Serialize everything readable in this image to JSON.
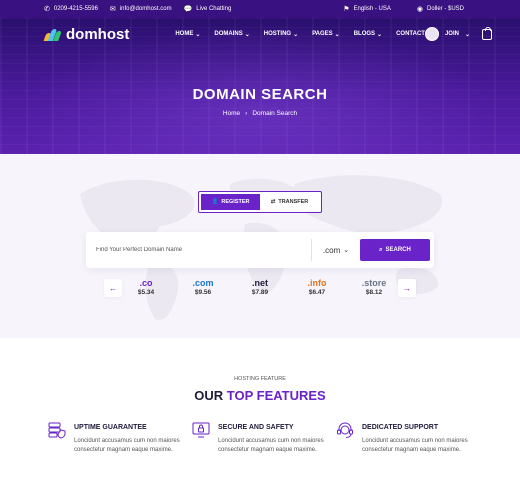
{
  "topbar": {
    "phone": "0209-4215-5596",
    "email": "info@domhost.com",
    "chat": "Live Chatting",
    "language": "English - USA",
    "currency": "Doller - $USD"
  },
  "brand": {
    "name": "domhost"
  },
  "nav": {
    "items": [
      {
        "label": "HOME"
      },
      {
        "label": "DOMAINS"
      },
      {
        "label": "HOSTING"
      },
      {
        "label": "PAGES"
      },
      {
        "label": "BLOGS"
      },
      {
        "label": "CONTACT"
      }
    ],
    "join": "JOIN"
  },
  "hero": {
    "title": "DOMAIN SEARCH",
    "breadcrumb": {
      "home": "Home",
      "separator": "›",
      "current": "Domain Search"
    }
  },
  "search": {
    "tabs": {
      "register": "REGISTER",
      "transfer": "TRANSFER"
    },
    "placeholder": "Find Your Perfect Domain Name",
    "tld_selected": ".com",
    "button": "SEARCH",
    "tlds": [
      {
        "ext": ".co",
        "price": "$5.34",
        "color": "#6a22c9"
      },
      {
        "ext": ".com",
        "price": "$9.56",
        "color": "#1a73c8"
      },
      {
        "ext": ".net",
        "price": "$7.89",
        "color": "#1f1b3a"
      },
      {
        "ext": ".info",
        "price": "$6.47",
        "color": "#e8731a"
      },
      {
        "ext": ".store",
        "price": "$8.12",
        "color": "#6a7487"
      }
    ]
  },
  "features": {
    "subtitle": "HOSTING FEATURE",
    "title_plain": "OUR ",
    "title_accent": "TOP FEATURES",
    "items": [
      {
        "icon": "server-shield-icon",
        "title": "UPTIME GUARANTEE",
        "text": "Loncidunt accusamus cum non maiores consectetur magnam eaque maxime."
      },
      {
        "icon": "lock-screen-icon",
        "title": "SECURE AND SAFETY",
        "text": "Loncidunt accusamus cum non maiores consectetur magnam eaque maxime."
      },
      {
        "icon": "headset-icon",
        "title": "DEDICATED SUPPORT",
        "text": "Loncidunt accusamus cum non maiores consectetur magnam eaque maxime."
      }
    ]
  },
  "colors": {
    "primary": "#6a22c9",
    "topbar": "#3a1180",
    "dark": "#1f1b3a"
  }
}
